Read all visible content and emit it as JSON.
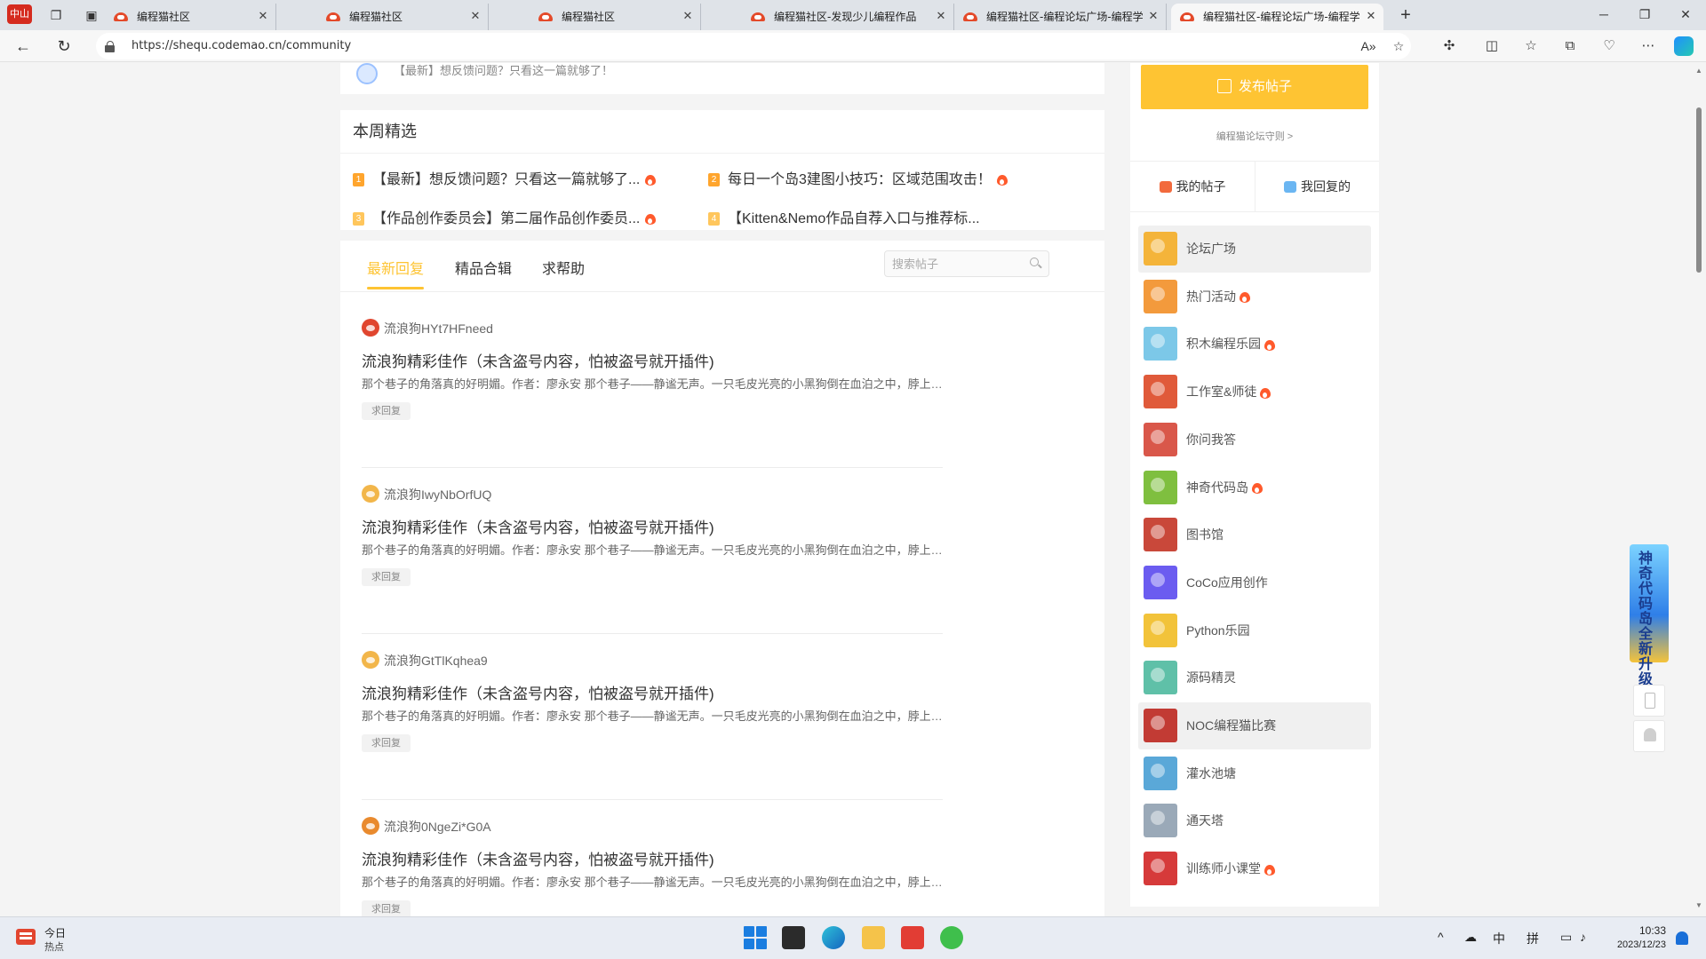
{
  "browser": {
    "tabs": [
      {
        "title": "编程猫社区"
      },
      {
        "title": "编程猫社区"
      },
      {
        "title": "编程猫社区"
      },
      {
        "title": "编程猫社区-发现少儿编程作品"
      },
      {
        "title": "编程猫社区-编程论坛广场-编程学"
      },
      {
        "title": "编程猫社区-编程论坛广场-编程学"
      }
    ],
    "app_badge": "中山",
    "url": "https://shequ.codemao.cn/community"
  },
  "page": {
    "notice": "【最新】想反馈问题？只看这一篇就够了！",
    "weekly": {
      "title": "本周精选",
      "items": [
        {
          "num": "1",
          "text": "【最新】想反馈问题？只看这一篇就够了...",
          "hot": true
        },
        {
          "num": "2",
          "text": "每日一个岛3建图小技巧：区域范围攻击！",
          "hot": true
        },
        {
          "num": "3",
          "text": "【作品创作委员会】第二届作品创作委员...",
          "hot": true
        },
        {
          "num": "4",
          "text": "【Kitten&Nemo作品自荐入口与推荐标...",
          "hot": false
        }
      ]
    },
    "post_tabs": [
      "最新回复",
      "精品合辑",
      "求帮助"
    ],
    "search_placeholder": "搜索帖子",
    "posts": [
      {
        "user": "流浪狗HYt7HFneed",
        "title": "流浪狗精彩佳作（未含盗号内容，怕被盗号就开插件)",
        "summary": "那个巷子的角落真的好明媚。作者：廖永安 那个巷子——静谧无声。一只毛皮光亮的小黑狗倒在血泊之中，脖上挂着很精致的...",
        "tag": "求回复",
        "avatar_color": "#e0462f"
      },
      {
        "user": "流浪狗IwyNbOrfUQ",
        "title": "流浪狗精彩佳作（未含盗号内容，怕被盗号就开插件)",
        "summary": "那个巷子的角落真的好明媚。作者：廖永安 那个巷子——静谧无声。一只毛皮光亮的小黑狗倒在血泊之中，脖上挂着很精致的...",
        "tag": "求回复",
        "avatar_color": "#f2b64a"
      },
      {
        "user": "流浪狗GtTlKqhea9",
        "title": "流浪狗精彩佳作（未含盗号内容，怕被盗号就开插件)",
        "summary": "那个巷子的角落真的好明媚。作者：廖永安 那个巷子——静谧无声。一只毛皮光亮的小黑狗倒在血泊之中，脖上挂着很精致的...",
        "tag": "求回复",
        "avatar_color": "#f2b64a"
      },
      {
        "user": "流浪狗0NgeZi*G0A",
        "title": "流浪狗精彩佳作（未含盗号内容，怕被盗号就开插件)",
        "summary": "那个巷子的角落真的好明媚。作者：廖永安 那个巷子——静谧无声。一只毛皮光亮的小黑狗倒在血泊之中，脖上挂着很精致的...",
        "tag": "求回复",
        "avatar_color": "#e98a2e"
      }
    ]
  },
  "sidebar": {
    "publish": "发布帖子",
    "rules": "编程猫论坛守则 >",
    "my_posts": "我的帖子",
    "my_replies": "我回复的",
    "forums": [
      {
        "label": "论坛广场",
        "hot": false,
        "highlight": true,
        "color": "#f4b43a"
      },
      {
        "label": "热门活动",
        "hot": true,
        "highlight": false,
        "color": "#f39a3c"
      },
      {
        "label": "积木编程乐园",
        "hot": true,
        "highlight": false,
        "color": "#7cc8e8"
      },
      {
        "label": "工作室&师徒",
        "hot": true,
        "highlight": false,
        "color": "#e05a3a"
      },
      {
        "label": "你问我答",
        "hot": false,
        "highlight": false,
        "color": "#d9574a"
      },
      {
        "label": "神奇代码岛",
        "hot": true,
        "highlight": false,
        "color": "#7fbf3f"
      },
      {
        "label": "图书馆",
        "hot": false,
        "highlight": false,
        "color": "#c9483a"
      },
      {
        "label": "CoCo应用创作",
        "hot": false,
        "highlight": false,
        "color": "#6b5cf0"
      },
      {
        "label": "Python乐园",
        "hot": false,
        "highlight": false,
        "color": "#f2c33a"
      },
      {
        "label": "源码精灵",
        "hot": false,
        "highlight": false,
        "color": "#5fc0a8"
      },
      {
        "label": "NOC编程猫比赛",
        "hot": false,
        "highlight": true,
        "color": "#c23b34"
      },
      {
        "label": "灌水池塘",
        "hot": false,
        "highlight": false,
        "color": "#5aa8d8"
      },
      {
        "label": "通天塔",
        "hot": false,
        "highlight": false,
        "color": "#9aa9b8"
      },
      {
        "label": "训练师小课堂",
        "hot": true,
        "highlight": false,
        "color": "#d63a3a"
      }
    ],
    "promo_text": "神奇代码岛全新升级"
  },
  "taskbar": {
    "news_line1": "今日",
    "news_line2": "热点",
    "ime_lang": "中",
    "ime_mode": "拼",
    "time": "10:33",
    "date": "2023/12/23"
  },
  "colors": {
    "accent": "#fec433",
    "hot": "#ff5a2c"
  }
}
